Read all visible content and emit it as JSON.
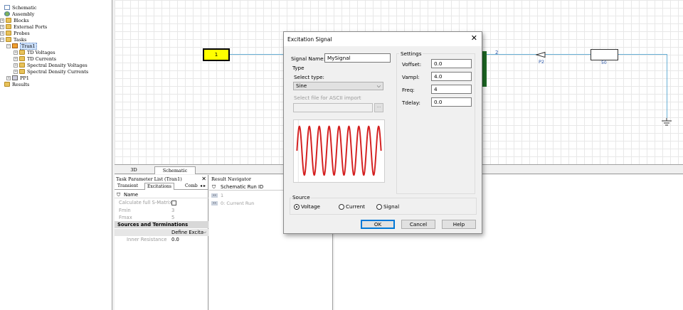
{
  "tree": {
    "items": [
      {
        "label": "Schematic",
        "icon": "schematic-icon"
      },
      {
        "label": "Assembly",
        "icon": "assembly-icon"
      },
      {
        "label": "Blocks",
        "icon": "folder-icon"
      },
      {
        "label": "External Ports",
        "icon": "folder-icon"
      },
      {
        "label": "Probes",
        "icon": "folder-icon"
      },
      {
        "label": "Tasks",
        "icon": "folder-icon"
      },
      {
        "label": "Tran1",
        "icon": "task-icon"
      },
      {
        "label": "TD Voltages",
        "icon": "folder-icon"
      },
      {
        "label": "TD Currents",
        "icon": "folder-icon"
      },
      {
        "label": "Spectral Density Voltages",
        "icon": "folder-icon"
      },
      {
        "label": "Spectral Density Currents",
        "icon": "folder-icon"
      },
      {
        "label": "PP1",
        "icon": "post-processing-icon"
      },
      {
        "label": "Results",
        "icon": "folder-icon"
      }
    ]
  },
  "schematic": {
    "port_block_label": "1",
    "port_label_2": "2",
    "probe_label": "P2",
    "resistor_label": "50"
  },
  "view_tabs": [
    "3D",
    "Schematic"
  ],
  "task_panel": {
    "title": "Task Parameter List (Tran1)",
    "tabs": [
      "Transient",
      "Excitations",
      "Comb",
      "◂ ▸"
    ],
    "header": "Name",
    "rows": [
      {
        "label": "Calculate full S-Matrix",
        "value": ""
      },
      {
        "label": "Fmin",
        "value": "3"
      },
      {
        "label": "Fmax",
        "value": "5"
      }
    ],
    "group": "Sources and Terminations",
    "define_label": "Define Excita",
    "inner_resistance": {
      "label": "Inner Resistance",
      "value": "0.0"
    }
  },
  "result_nav": {
    "title": "Result Navigator",
    "header": "Schematic Run ID",
    "rows": [
      {
        "pin": "••",
        "text": "1"
      },
      {
        "pin": "••",
        "text": "0: Current Run"
      }
    ]
  },
  "dialog": {
    "title": "Excitation Signal",
    "signal_name_label": "Signal Name:",
    "signal_name_value": "MySignal",
    "type_group": "Type",
    "select_type_label": "Select type:",
    "select_type_value": "Sine",
    "ascii_label": "Select file for ASCII import",
    "browse_label": "...",
    "settings_group": "Settings",
    "settings": [
      {
        "label": "Voffset:",
        "value": "0.0"
      },
      {
        "label": "Vampl:",
        "value": "4.0"
      },
      {
        "label": "Freq:",
        "value": "4"
      },
      {
        "label": "Tdelay:",
        "value": "0.0"
      }
    ],
    "source_group": "Source",
    "source_options": [
      "Voltage",
      "Current",
      "Signal"
    ],
    "source_selected": "Voltage",
    "buttons": {
      "ok": "OK",
      "cancel": "Cancel",
      "help": "Help"
    },
    "preview": {
      "cycles": 8.5,
      "color": "#d42020"
    }
  },
  "colors": {
    "accent": "#0078d7",
    "wire": "#6ab0d6",
    "port_fill": "#ffff00",
    "block_fill": "#1e6b25"
  }
}
